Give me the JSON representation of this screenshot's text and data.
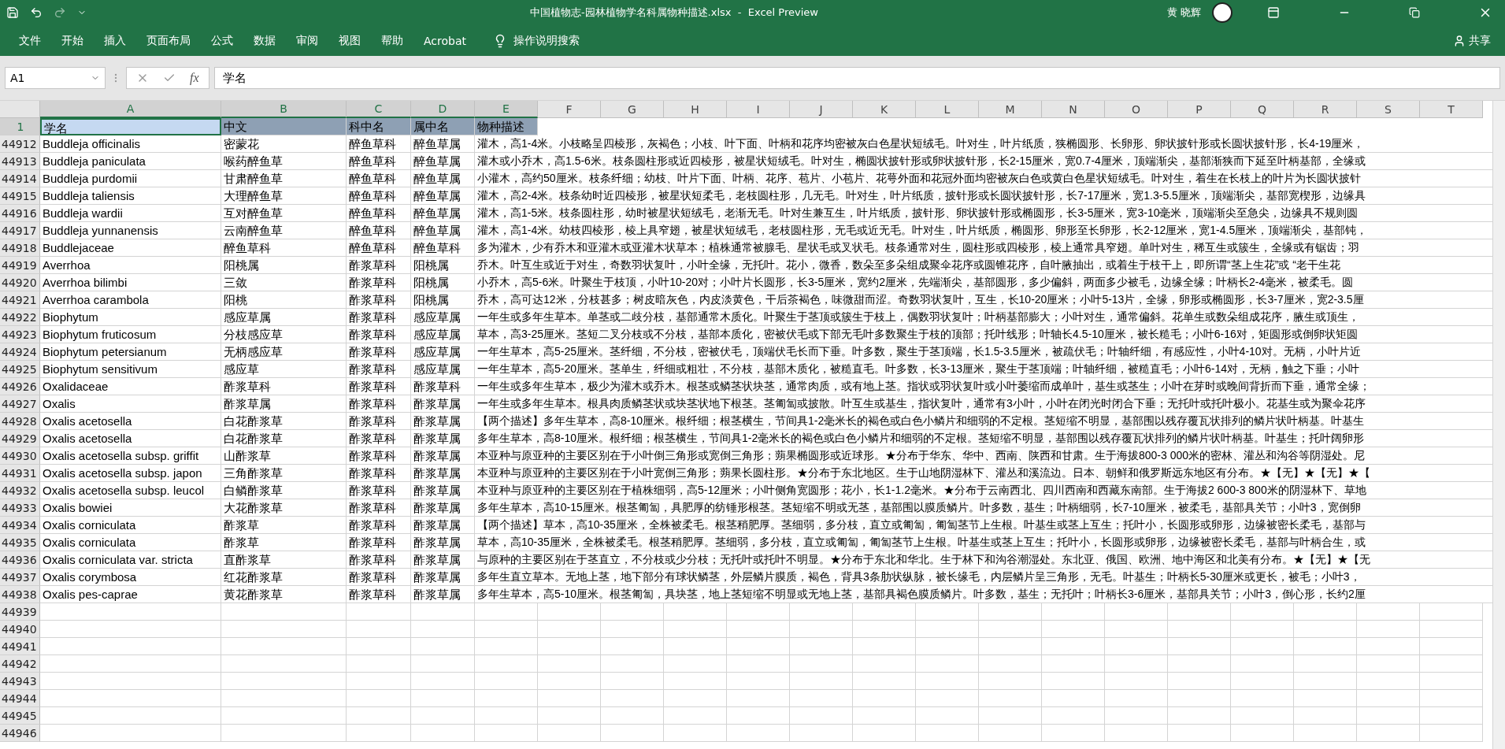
{
  "window": {
    "title": "中国植物志-园林植物学名科属物种描述.xlsx  -  Excel Preview",
    "user": "黄 晓辉"
  },
  "ribbon_tabs": [
    "文件",
    "开始",
    "插入",
    "页面布局",
    "公式",
    "数据",
    "审阅",
    "视图",
    "帮助",
    "Acrobat"
  ],
  "tell_me": "操作说明搜索",
  "share": "共享",
  "formula_bar": {
    "name_box": "A1",
    "function_label": "fx",
    "content": "学名"
  },
  "columns": [
    {
      "label": "A",
      "selected": true
    },
    {
      "label": "B",
      "selected": true
    },
    {
      "label": "C",
      "selected": true
    },
    {
      "label": "D",
      "selected": true
    },
    {
      "label": "E",
      "selected": true
    },
    {
      "label": "F",
      "selected": false
    },
    {
      "label": "G",
      "selected": false
    },
    {
      "label": "H",
      "selected": false
    },
    {
      "label": "I",
      "selected": false
    },
    {
      "label": "J",
      "selected": false
    },
    {
      "label": "K",
      "selected": false
    },
    {
      "label": "L",
      "selected": false
    },
    {
      "label": "M",
      "selected": false
    },
    {
      "label": "N",
      "selected": false
    },
    {
      "label": "O",
      "selected": false
    },
    {
      "label": "P",
      "selected": false
    },
    {
      "label": "Q",
      "selected": false
    },
    {
      "label": "R",
      "selected": false
    },
    {
      "label": "S",
      "selected": false
    },
    {
      "label": "T",
      "selected": false
    }
  ],
  "header_row": {
    "number": "1",
    "cells": [
      {
        "text": "学名",
        "active": true
      },
      {
        "text": "中文",
        "active": false
      },
      {
        "text": "科中名",
        "active": false
      },
      {
        "text": "属中名",
        "active": false
      },
      {
        "text": "物种描述",
        "active": false
      }
    ]
  },
  "rows": [
    {
      "number": "44912",
      "cells": [
        "Buddleja officinalis",
        "密蒙花",
        "醉鱼草科",
        "醉鱼草属",
        "灌木，高1-4米。小枝略呈四棱形，灰褐色；小枝、叶下面、叶柄和花序均密被灰白色星状短绒毛。叶对生，叶片纸质，狭椭圆形、长卵形、卵状披针形或长圆状披针形，长4-19厘米，"
      ]
    },
    {
      "number": "44913",
      "cells": [
        "Buddleja paniculata",
        "喉药醉鱼草",
        "醉鱼草科",
        "醉鱼草属",
        "灌木或小乔木，高1.5-6米。枝条圆柱形或近四棱形，被星状短绒毛。叶对生，椭圆状披针形或卵状披针形，长2-15厘米，宽0.7-4厘米，顶端渐尖，基部渐狭而下延至叶柄基部，全缘或"
      ]
    },
    {
      "number": "44914",
      "cells": [
        "Buddleja purdomii",
        "甘肃醉鱼草",
        "醉鱼草科",
        "醉鱼草属",
        "小灌木，高约50厘米。枝条纤细；幼枝、叶片下面、叶柄、花序、苞片、小苞片、花萼外面和花冠外面均密被灰白色或黄白色星状短绒毛。叶对生，着生在长枝上的叶片为长圆状披针"
      ]
    },
    {
      "number": "44915",
      "cells": [
        "Buddleja taliensis",
        "大理醉鱼草",
        "醉鱼草科",
        "醉鱼草属",
        "灌木，高2-4米。枝条幼时近四棱形，被星状短柔毛，老枝圆柱形，几无毛。叶对生，叶片纸质，披针形或长圆状披针形，长7-17厘米，宽1.3-5.5厘米，顶端渐尖，基部宽楔形，边缘具"
      ]
    },
    {
      "number": "44916",
      "cells": [
        "Buddleja wardii",
        "互对醉鱼草",
        "醉鱼草科",
        "醉鱼草属",
        "灌木，高1-5米。枝条圆柱形，幼时被星状短绒毛，老渐无毛。叶对生兼互生，叶片纸质，披针形、卵状披针形或椭圆形，长3-5厘米，宽3-10毫米，顶端渐尖至急尖，边缘具不规则圆"
      ]
    },
    {
      "number": "44917",
      "cells": [
        "Buddleja yunnanensis",
        "云南醉鱼草",
        "醉鱼草科",
        "醉鱼草属",
        "灌木，高1-4米。幼枝四棱形，棱上具窄翅，被星状短绒毛，老枝圆柱形，无毛或近无毛。叶对生，叶片纸质，椭圆形、卵形至长卵形，长2-12厘米，宽1-4.5厘米，顶端渐尖，基部钝，"
      ]
    },
    {
      "number": "44918",
      "cells": [
        "Buddlejaceae",
        "醉鱼草科",
        "醉鱼草科",
        "醉鱼草科",
        "多为灌木，少有乔木和亚灌木或亚灌木状草本；植株通常被腺毛、星状毛或叉状毛。枝条通常对生，圆柱形或四棱形，棱上通常具窄翅。单叶对生，稀互生或簇生，全缘或有锯齿；羽"
      ]
    },
    {
      "number": "44919",
      "cells": [
        "Averrhoa",
        "阳桃属",
        "酢浆草科",
        "阳桃属",
        "乔木。叶互生或近于对生，奇数羽状复叶，小叶全缘，无托叶。花小，微香，数朵至多朵组成聚伞花序或圆锥花序，自叶腋抽出，或着生于枝干上，即所谓“茎上生花”或 “老干生花"
      ]
    },
    {
      "number": "44920",
      "cells": [
        "Averrhoa bilimbi",
        "三敛",
        "酢浆草科",
        "阳桃属",
        "小乔木，高5-6米。叶聚生于枝顶，小叶10-20对；小叶片长圆形，长3-5厘米，宽约2厘米，先端渐尖，基部圆形，多少偏斜，两面多少被毛，边缘全缘；叶柄长2-4毫米，被柔毛。圆"
      ]
    },
    {
      "number": "44921",
      "cells": [
        "Averrhoa carambola",
        "阳桃",
        "酢浆草科",
        "阳桃属",
        "乔木，高可达12米，分枝甚多；树皮暗灰色，内皮淡黄色，干后茶褐色，味微甜而涩。奇数羽状复叶，互生，长10-20厘米；小叶5-13片，全缘，卵形或椭圆形，长3-7厘米，宽2-3.5厘"
      ]
    },
    {
      "number": "44922",
      "cells": [
        "Biophytum",
        "感应草属",
        "酢浆草科",
        "感应草属",
        "一年生或多年生草本。单茎或二歧分枝，基部通常木质化。叶聚生于茎顶或簇生于枝上，偶数羽状复叶；叶柄基部膨大；小叶对生，通常偏斜。花单生或数朵组成花序，腋生或顶生，"
      ]
    },
    {
      "number": "44923",
      "cells": [
        "Biophytum fruticosum",
        "分枝感应草",
        "酢浆草科",
        "感应草属",
        "草本，高3-25厘米。茎短二叉分枝或不分枝，基部本质化，密被伏毛或下部无毛叶多数聚生于枝的顶部；托叶线形；叶轴长4.5-10厘米，被长糙毛；小叶6-16对，矩圆形或倒卵状矩圆"
      ]
    },
    {
      "number": "44924",
      "cells": [
        "Biophytum petersianum",
        "无柄感应草",
        "酢浆草科",
        "感应草属",
        "一年生草本，高5-25厘米。茎纤细，不分枝，密被伏毛，顶端伏毛长而下垂。叶多数，聚生于茎顶端，长1.5-3.5厘米，被疏伏毛；叶轴纤细，有感应性，小叶4-10对。无柄，小叶片近"
      ]
    },
    {
      "number": "44925",
      "cells": [
        "Biophytum sensitivum",
        "感应草",
        "酢浆草科",
        "感应草属",
        "一年生草本，高5-20厘米。茎单生，纤细或粗壮，不分枝，基部木质化，被糙直毛。叶多数，长3-13厘米，聚生于茎顶端；叶轴纤细，被糙直毛；小叶6-14对，无柄，触之下垂；小叶"
      ]
    },
    {
      "number": "44926",
      "cells": [
        "Oxalidaceae",
        "酢浆草科",
        "酢浆草科",
        "酢浆草科",
        "一年生或多年生草本，极少为灌木或乔木。根茎或鳞茎状块茎，通常肉质，或有地上茎。指状或羽状复叶或小叶萎缩而成单叶，基生或茎生；小叶在芽时或晚间背折而下垂，通常全缘；"
      ]
    },
    {
      "number": "44927",
      "cells": [
        "Oxalis",
        "酢浆草属",
        "酢浆草科",
        "酢浆草属",
        "一年生或多年生草本。根具肉质鳞茎状或块茎状地下根茎。茎匍匐或披散。叶互生或基生，指状复叶，通常有3小叶，小叶在闭光时闭合下垂；无托叶或托叶极小。花基生或为聚伞花序"
      ]
    },
    {
      "number": "44928",
      "cells": [
        "Oxalis acetosella",
        "白花酢浆草",
        "酢浆草科",
        "酢浆草属",
        "【两个描述】多年生草本，高8-10厘米。根纤细；根茎横生，节间具1-2毫米长的褐色或白色小鳞片和细弱的不定根。茎短缩不明显，基部围以残存覆瓦状排列的鳞片状叶柄基。叶基生"
      ]
    },
    {
      "number": "44929",
      "cells": [
        "Oxalis acetosella",
        "白花酢浆草",
        "酢浆草科",
        "酢浆草属",
        "多年生草本，高8-10厘米。根纤细；根茎横生，节间具1-2毫米长的褐色或白色小鳞片和细弱的不定根。茎短缩不明显，基部围以残存覆瓦状排列的鳞片状叶柄基。叶基生；托叶阔卵形"
      ]
    },
    {
      "number": "44930",
      "cells": [
        "Oxalis acetosella subsp. griffit",
        "山酢浆草",
        "酢浆草科",
        "酢浆草属",
        "本亚种与原亚种的主要区别在于小叶倒三角形或宽倒三角形；蒴果椭圆形或近球形。★分布于华东、华中、西南、陕西和甘肃。生于海拔800-3 000米的密林、灌丛和沟谷等阴湿处。尼"
      ]
    },
    {
      "number": "44931",
      "cells": [
        "Oxalis acetosella subsp. japon",
        "三角酢浆草",
        "酢浆草科",
        "酢浆草属",
        "本亚种与原亚种的主要区别在于小叶宽倒三角形；蒴果长圆柱形。★分布于东北地区。生于山地阴湿林下、灌丛和溪流边。日本、朝鲜和俄罗斯远东地区有分布。★【无】★【无】★【"
      ]
    },
    {
      "number": "44932",
      "cells": [
        "Oxalis acetosella subsp. leucol",
        "白鳞酢浆草",
        "酢浆草科",
        "酢浆草属",
        "本亚种与原亚种的主要区别在于植株细弱，高5-12厘米；小叶侧角宽圆形；花小，长1-1.2毫米。★分布于云南西北、四川西南和西藏东南部。生于海拔2 600-3 800米的阴湿林下、草地"
      ]
    },
    {
      "number": "44933",
      "cells": [
        "Oxalis bowiei",
        "大花酢浆草",
        "酢浆草科",
        "酢浆草属",
        "多年生草本，高10-15厘米。根茎匍匐，具肥厚的纺锤形根茎。茎短缩不明或无茎，基部围以膜质鳞片。叶多数，基生；叶柄细弱，长7-10厘米，被柔毛，基部具关节；小叶3，宽倒卵"
      ]
    },
    {
      "number": "44934",
      "cells": [
        "Oxalis corniculata",
        "酢浆草",
        "酢浆草科",
        "酢浆草属",
        "【两个描述】草本，高10-35厘米，全株被柔毛。根茎稍肥厚。茎细弱，多分枝，直立或匍匐，匍匐茎节上生根。叶基生或茎上互生；托叶小，长圆形或卵形，边缘被密长柔毛，基部与"
      ]
    },
    {
      "number": "44935",
      "cells": [
        "Oxalis corniculata",
        "酢浆草",
        "酢浆草科",
        "酢浆草属",
        "草本，高10-35厘米，全株被柔毛。根茎稍肥厚。茎细弱，多分枝，直立或匍匐，匍匐茎节上生根。叶基生或茎上互生；托叶小，长圆形或卵形，边缘被密长柔毛，基部与叶柄合生，或"
      ]
    },
    {
      "number": "44936",
      "cells": [
        "Oxalis corniculata var. stricta",
        "直酢浆草",
        "酢浆草科",
        "酢浆草属",
        "与原种的主要区别在于茎直立，不分枝或少分枝；无托叶或托叶不明显。★分布于东北和华北。生于林下和沟谷潮湿处。东北亚、俄国、欧洲、地中海区和北美有分布。★【无】★【无"
      ]
    },
    {
      "number": "44937",
      "cells": [
        "Oxalis corymbosa",
        "红花酢浆草",
        "酢浆草科",
        "酢浆草属",
        "多年生直立草本。无地上茎，地下部分有球状鳞茎，外层鳞片膜质，褐色，背具3条肋状纵脉，被长缘毛，内层鳞片呈三角形，无毛。叶基生；叶柄长5-30厘米或更长，被毛；小叶3，"
      ]
    },
    {
      "number": "44938",
      "cells": [
        "Oxalis pes-caprae",
        "黄花酢浆草",
        "酢浆草科",
        "酢浆草属",
        "多年生草本，高5-10厘米。根茎匍匐，具块茎，地上茎短缩不明显或无地上茎，基部具褐色膜质鳞片。叶多数，基生；无托叶；叶柄长3-6厘米，基部具关节；小叶3，倒心形，长约2厘"
      ]
    }
  ],
  "empty_rows": [
    "44939",
    "44940",
    "44941",
    "44942",
    "44943",
    "44944",
    "44945",
    "44946"
  ]
}
